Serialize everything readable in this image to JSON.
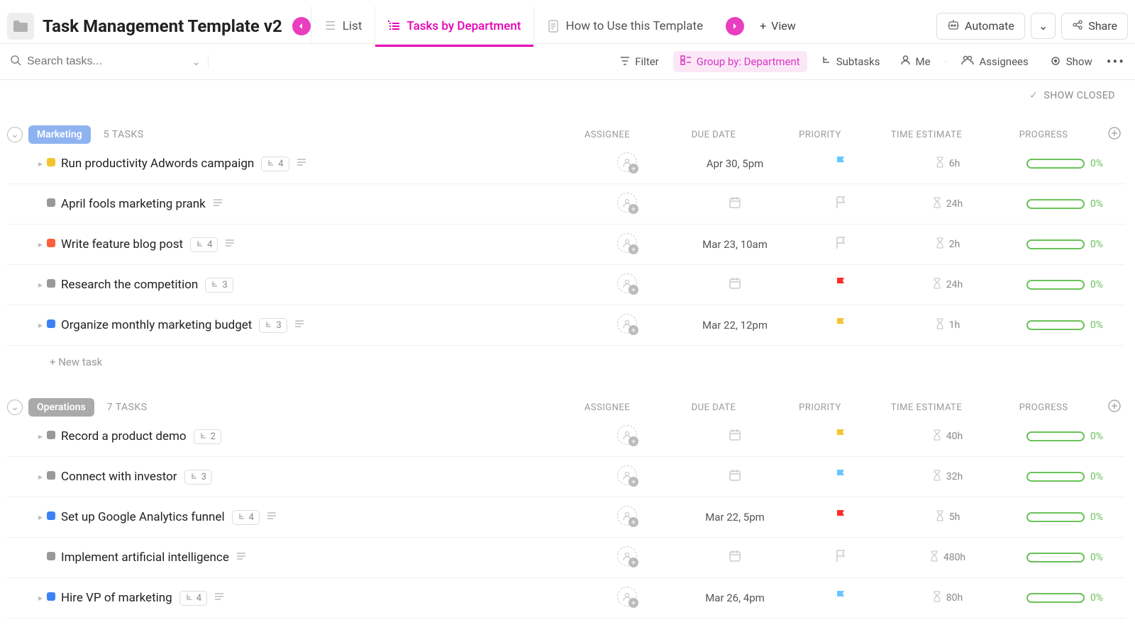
{
  "header": {
    "title": "Task Management Template v2",
    "views": [
      {
        "label": "List"
      },
      {
        "label": "Tasks by Department",
        "active": true
      },
      {
        "label": "How to Use this Template"
      }
    ],
    "add_view": "View",
    "automate": "Automate",
    "share": "Share"
  },
  "toolbar": {
    "search_placeholder": "Search tasks...",
    "filter": "Filter",
    "group_by": "Group by: Department",
    "subtasks": "Subtasks",
    "me": "Me",
    "assignees": "Assignees",
    "show": "Show"
  },
  "show_closed": "SHOW CLOSED",
  "columns": {
    "assignee": "ASSIGNEE",
    "due": "DUE DATE",
    "priority": "PRIORITY",
    "time": "TIME ESTIMATE",
    "progress": "PROGRESS"
  },
  "new_task": "+ New task",
  "groups": [
    {
      "name": "Marketing",
      "class": "marketing",
      "count": "5 TASKS",
      "tasks": [
        {
          "status": "#f4c430",
          "name": "Run productivity Adwords campaign",
          "sub": "4",
          "desc": true,
          "caret": true,
          "due": "Apr 30, 5pm",
          "flag": "#67c7ff",
          "time": "6h",
          "pct": "0%"
        },
        {
          "status": "#999",
          "name": "April fools marketing prank",
          "desc": true,
          "caret": false,
          "due": "",
          "flag": "#ddd",
          "time": "24h",
          "pct": "0%"
        },
        {
          "status": "#ff5e3a",
          "name": "Write feature blog post",
          "sub": "4",
          "desc": true,
          "caret": true,
          "due": "Mar 23, 10am",
          "flag": "#ccc",
          "time": "2h",
          "pct": "0%"
        },
        {
          "status": "#999",
          "name": "Research the competition",
          "sub": "3",
          "caret": true,
          "due": "",
          "flag": "#ff2d2d",
          "time": "24h",
          "pct": "0%"
        },
        {
          "status": "#3b82f6",
          "name": "Organize monthly marketing budget",
          "sub": "3",
          "desc": true,
          "caret": true,
          "due": "Mar 22, 12pm",
          "flag": "#f4c430",
          "time": "1h",
          "pct": "0%"
        }
      ]
    },
    {
      "name": "Operations",
      "class": "operations",
      "count": "7 TASKS",
      "tasks": [
        {
          "status": "#999",
          "name": "Record a product demo",
          "sub": "2",
          "caret": true,
          "due": "",
          "flag": "#f4c430",
          "time": "40h",
          "pct": "0%"
        },
        {
          "status": "#999",
          "name": "Connect with investor",
          "sub": "3",
          "caret": true,
          "due": "",
          "flag": "#67c7ff",
          "time": "32h",
          "pct": "0%"
        },
        {
          "status": "#3b82f6",
          "name": "Set up Google Analytics funnel",
          "sub": "4",
          "desc": true,
          "caret": true,
          "due": "Mar 22, 5pm",
          "flag": "#ff2d2d",
          "time": "5h",
          "pct": "0%"
        },
        {
          "status": "#999",
          "name": "Implement artificial intelligence",
          "desc": true,
          "caret": false,
          "due": "",
          "flag": "#ddd",
          "time": "480h",
          "pct": "0%"
        },
        {
          "status": "#3b82f6",
          "name": "Hire VP of marketing",
          "sub": "4",
          "desc": true,
          "caret": true,
          "due": "Mar 26, 4pm",
          "flag": "#67c7ff",
          "time": "80h",
          "pct": "0%"
        }
      ]
    }
  ]
}
